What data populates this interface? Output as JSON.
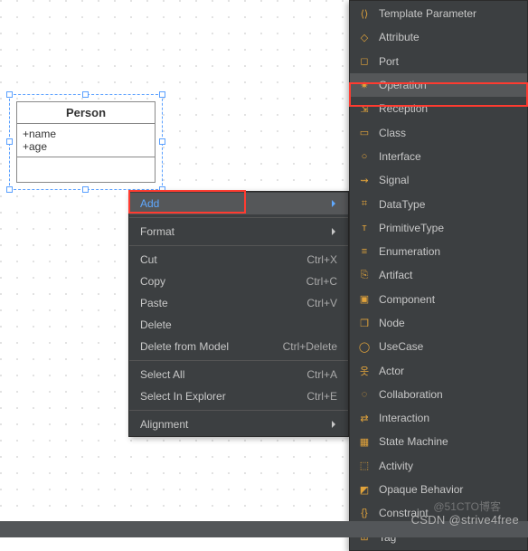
{
  "uml": {
    "name": "Person",
    "attrs": [
      "+name",
      "+age"
    ]
  },
  "context_menu": {
    "items": [
      {
        "label": "Add",
        "submenu": true,
        "highlight": true
      },
      {
        "sep": true
      },
      {
        "label": "Format",
        "submenu": true
      },
      {
        "sep": true
      },
      {
        "label": "Cut",
        "shortcut": "Ctrl+X"
      },
      {
        "label": "Copy",
        "shortcut": "Ctrl+C"
      },
      {
        "label": "Paste",
        "shortcut": "Ctrl+V"
      },
      {
        "label": "Delete"
      },
      {
        "label": "Delete from Model",
        "shortcut": "Ctrl+Delete"
      },
      {
        "sep": true
      },
      {
        "label": "Select All",
        "shortcut": "Ctrl+A"
      },
      {
        "label": "Select In Explorer",
        "shortcut": "Ctrl+E"
      },
      {
        "sep": true
      },
      {
        "label": "Alignment",
        "submenu": true
      }
    ]
  },
  "add_submenu": {
    "items": [
      {
        "label": "Template Parameter",
        "icon": "⟨⟩"
      },
      {
        "label": "Attribute",
        "icon": "◇"
      },
      {
        "label": "Port",
        "icon": "◻"
      },
      {
        "label": "Operation",
        "icon": "✷",
        "highlight": true
      },
      {
        "label": "Reception",
        "icon": "⇲"
      },
      {
        "label": "Class",
        "icon": "▭"
      },
      {
        "label": "Interface",
        "icon": "○"
      },
      {
        "label": "Signal",
        "icon": "⇝"
      },
      {
        "label": "DataType",
        "icon": "⌗"
      },
      {
        "label": "PrimitiveType",
        "icon": "ᴛ"
      },
      {
        "label": "Enumeration",
        "icon": "≡"
      },
      {
        "label": "Artifact",
        "icon": "⎘"
      },
      {
        "label": "Component",
        "icon": "▣"
      },
      {
        "label": "Node",
        "icon": "❒"
      },
      {
        "label": "UseCase",
        "icon": "◯"
      },
      {
        "label": "Actor",
        "icon": "옷"
      },
      {
        "label": "Collaboration",
        "icon": "◌"
      },
      {
        "label": "Interaction",
        "icon": "⇄"
      },
      {
        "label": "State Machine",
        "icon": "▦"
      },
      {
        "label": "Activity",
        "icon": "⬚"
      },
      {
        "label": "Opaque Behavior",
        "icon": "◩"
      },
      {
        "label": "Constraint",
        "icon": "{}"
      },
      {
        "label": "Tag",
        "icon": "⊞"
      }
    ]
  },
  "watermark": "CSDN @strive4free",
  "watermark2": "@51CTO博客"
}
